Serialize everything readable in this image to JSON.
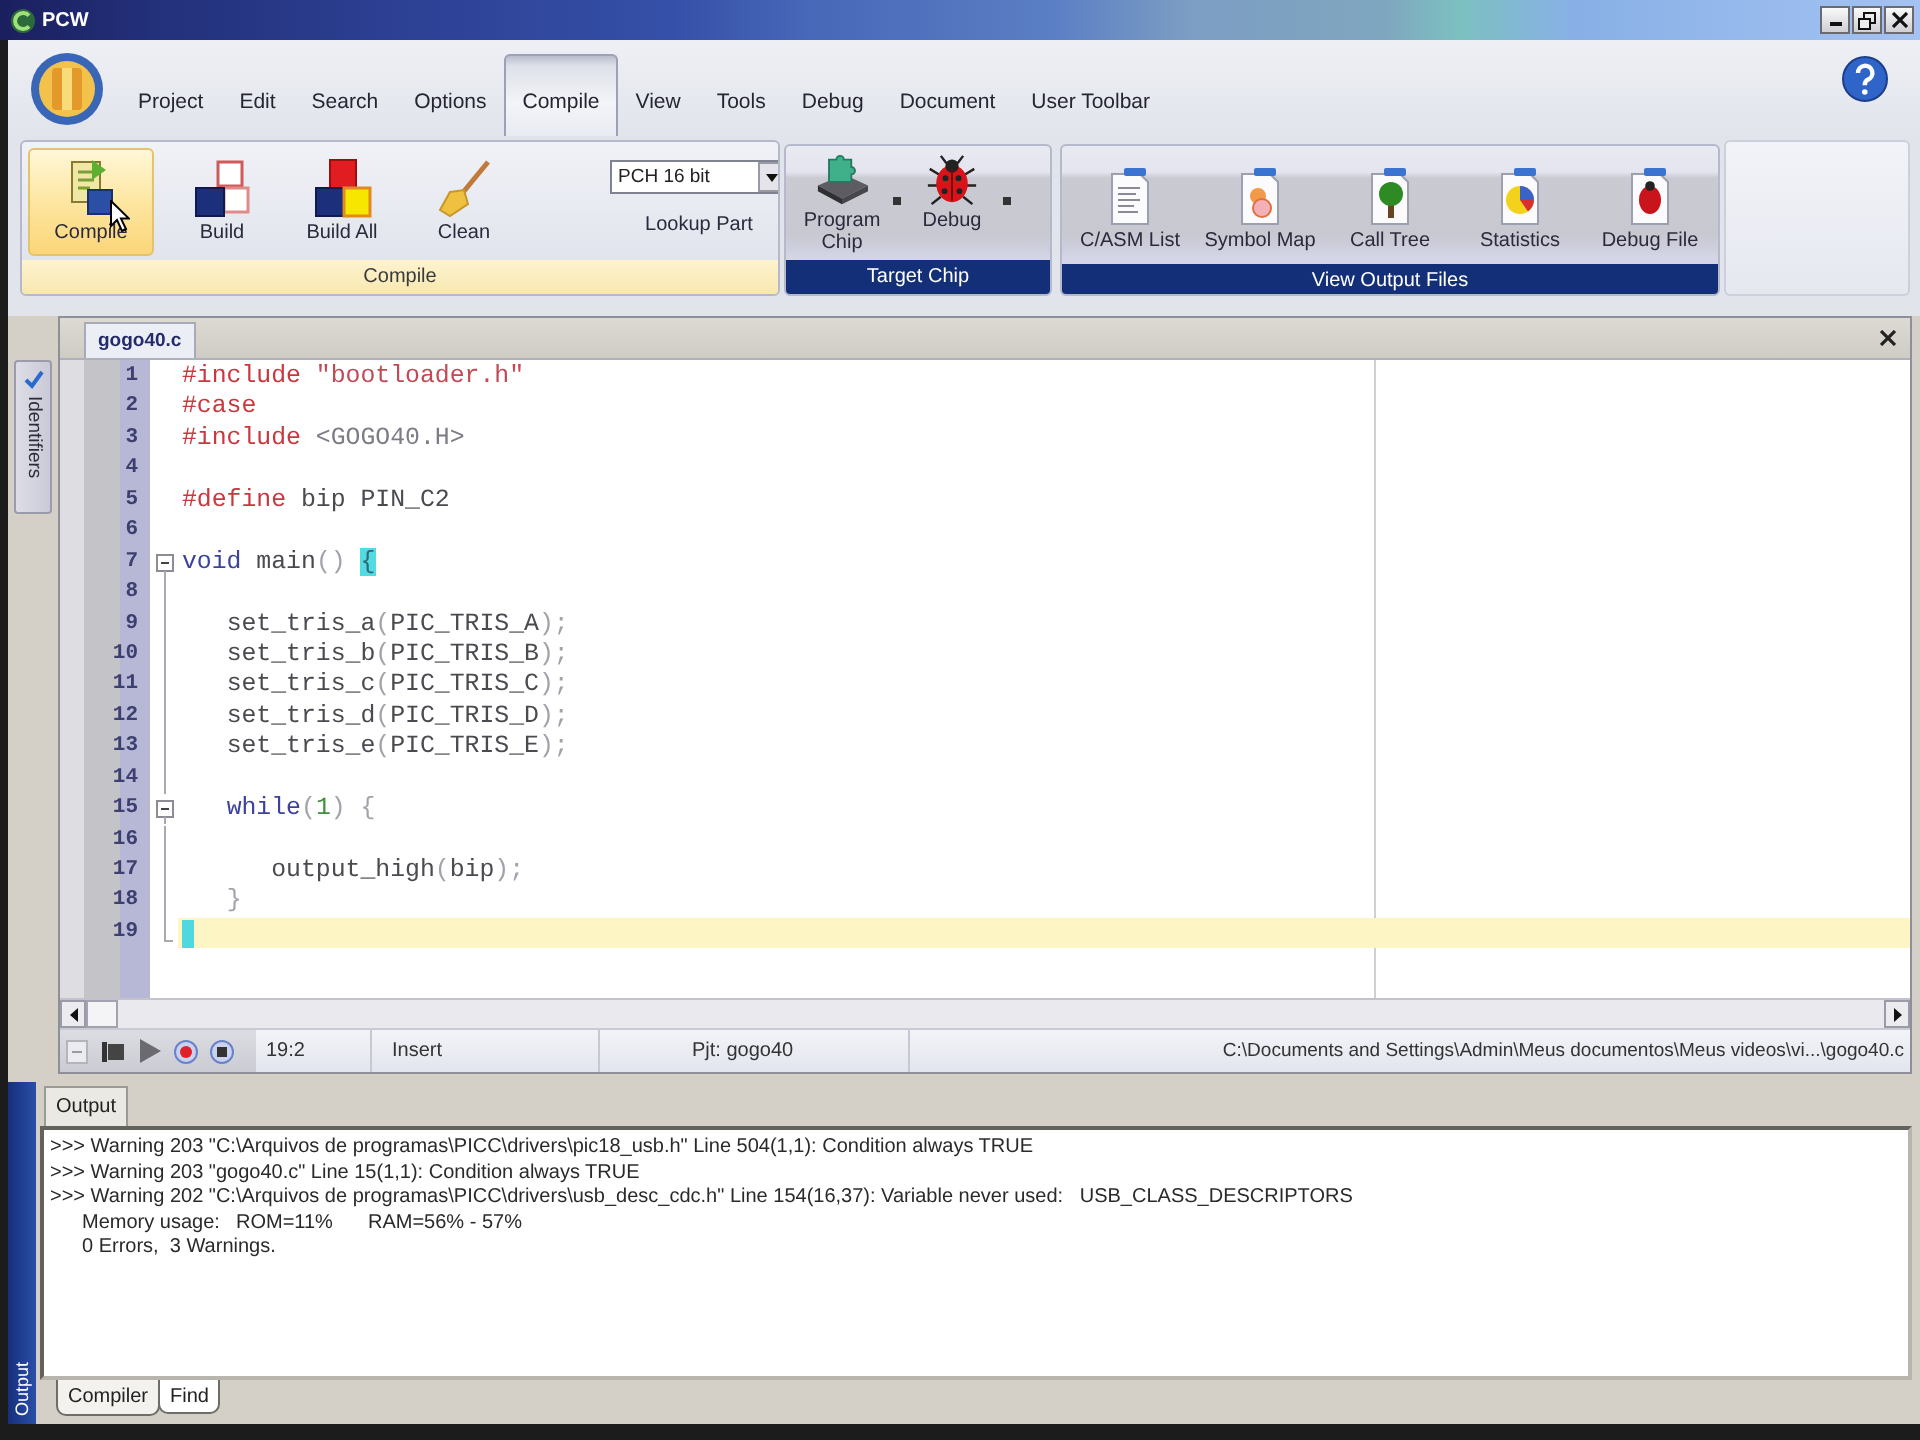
{
  "window": {
    "title": "PCW"
  },
  "menu": [
    {
      "label": "Project",
      "selected": false
    },
    {
      "label": "Edit",
      "selected": false
    },
    {
      "label": "Search",
      "selected": false
    },
    {
      "label": "Options",
      "selected": false
    },
    {
      "label": "Compile",
      "selected": true
    },
    {
      "label": "View",
      "selected": false
    },
    {
      "label": "Tools",
      "selected": false
    },
    {
      "label": "Debug",
      "selected": false
    },
    {
      "label": "Document",
      "selected": false
    },
    {
      "label": "User Toolbar",
      "selected": false
    }
  ],
  "ribbon": {
    "compile_group": {
      "label": "Compile",
      "active": true,
      "buttons": [
        {
          "label": "Compile",
          "hovered": true
        },
        {
          "label": "Build",
          "hovered": false
        },
        {
          "label": "Build All",
          "hovered": false
        },
        {
          "label": "Clean",
          "hovered": false
        }
      ],
      "compiler_select": {
        "value": "PCH 16 bit"
      },
      "lookup_button": {
        "label": "Lookup Part"
      }
    },
    "target_chip_group": {
      "label": "Target Chip",
      "active": false,
      "buttons": [
        {
          "label": "Program Chip",
          "hovered": false,
          "has_menu": true
        },
        {
          "label": "Debug",
          "hovered": false,
          "has_menu": true
        }
      ]
    },
    "output_files_group": {
      "label": "View Output Files",
      "active": false,
      "buttons": [
        {
          "label": "C/ASM List",
          "hovered": false
        },
        {
          "label": "Symbol Map",
          "hovered": false
        },
        {
          "label": "Call Tree",
          "hovered": false
        },
        {
          "label": "Statistics",
          "hovered": false
        },
        {
          "label": "Debug File",
          "hovered": false
        }
      ]
    }
  },
  "editor": {
    "side_tab": {
      "label": "Identifiers"
    },
    "tabs": [
      {
        "label": "gogo40.c",
        "selected": true
      }
    ],
    "lines": [
      {
        "number": "1",
        "tokens": [
          {
            "text": "#include ",
            "kind": "directive"
          },
          {
            "text": "\"bootloader.h\"",
            "kind": "string"
          }
        ],
        "collapsible": false,
        "current": false
      },
      {
        "number": "2",
        "tokens": [
          {
            "text": "#case",
            "kind": "directive"
          }
        ],
        "collapsible": false,
        "current": false
      },
      {
        "number": "3",
        "tokens": [
          {
            "text": "#include ",
            "kind": "directive"
          },
          {
            "text": "<GOGO40.H>",
            "kind": "header"
          }
        ],
        "collapsible": false,
        "current": false
      },
      {
        "number": "4",
        "collapsible": false,
        "current": false
      },
      {
        "number": "5",
        "tokens": [
          {
            "text": "#define ",
            "kind": "directive"
          },
          {
            "text": "bip PIN_C2",
            "kind": "ident"
          }
        ],
        "collapsible": false,
        "current": false
      },
      {
        "number": "6",
        "collapsible": false,
        "current": false
      },
      {
        "number": "7",
        "tokens": [
          {
            "text": "void",
            "kind": "keyword"
          },
          {
            "text": " main",
            "kind": "ident"
          },
          {
            "text": "() ",
            "kind": "punct"
          },
          {
            "text": "{",
            "kind": "brace_match"
          }
        ],
        "collapsible": true,
        "current": false
      },
      {
        "number": "8",
        "collapsible": false,
        "current": false
      },
      {
        "number": "9",
        "tokens": [
          {
            "text": "   set_tris_a",
            "kind": "ident"
          },
          {
            "text": "(",
            "kind": "punct"
          },
          {
            "text": "PIC_TRIS_A",
            "kind": "ident"
          },
          {
            "text": ");",
            "kind": "punct"
          }
        ],
        "collapsible": false,
        "current": false
      },
      {
        "number": "10",
        "tokens": [
          {
            "text": "   set_tris_b",
            "kind": "ident"
          },
          {
            "text": "(",
            "kind": "punct"
          },
          {
            "text": "PIC_TRIS_B",
            "kind": "ident"
          },
          {
            "text": ");",
            "kind": "punct"
          }
        ],
        "collapsible": false,
        "current": false
      },
      {
        "number": "11",
        "tokens": [
          {
            "text": "   set_tris_c",
            "kind": "ident"
          },
          {
            "text": "(",
            "kind": "punct"
          },
          {
            "text": "PIC_TRIS_C",
            "kind": "ident"
          },
          {
            "text": ");",
            "kind": "punct"
          }
        ],
        "collapsible": false,
        "current": false
      },
      {
        "number": "12",
        "tokens": [
          {
            "text": "   set_tris_d",
            "kind": "ident"
          },
          {
            "text": "(",
            "kind": "punct"
          },
          {
            "text": "PIC_TRIS_D",
            "kind": "ident"
          },
          {
            "text": ");",
            "kind": "punct"
          }
        ],
        "collapsible": false,
        "current": false
      },
      {
        "number": "13",
        "tokens": [
          {
            "text": "   set_tris_e",
            "kind": "ident"
          },
          {
            "text": "(",
            "kind": "punct"
          },
          {
            "text": "PIC_TRIS_E",
            "kind": "ident"
          },
          {
            "text": ");",
            "kind": "punct"
          }
        ],
        "collapsible": false,
        "current": false
      },
      {
        "number": "14",
        "collapsible": false,
        "current": false
      },
      {
        "number": "15",
        "tokens": [
          {
            "text": "   while",
            "kind": "keyword"
          },
          {
            "text": "(",
            "kind": "punct"
          },
          {
            "text": "1",
            "kind": "number"
          },
          {
            "text": ") {",
            "kind": "punct"
          }
        ],
        "collapsible": true,
        "current": false
      },
      {
        "number": "16",
        "collapsible": false,
        "current": false
      },
      {
        "number": "17",
        "tokens": [
          {
            "text": "      output_high",
            "kind": "ident"
          },
          {
            "text": "(",
            "kind": "punct"
          },
          {
            "text": "bip",
            "kind": "ident"
          },
          {
            "text": ");",
            "kind": "punct"
          }
        ],
        "collapsible": false,
        "current": false
      },
      {
        "number": "18",
        "tokens": [
          {
            "text": "   }",
            "kind": "punct"
          }
        ],
        "collapsible": false,
        "current": false
      },
      {
        "number": "19",
        "collapsible": false,
        "current": true
      }
    ],
    "status": {
      "position": "19:2",
      "mode": "Insert",
      "project": "Pjt: gogo40",
      "path": "C:\\Documents and Settings\\Admin\\Meus documentos\\Meus videos\\vi...\\gogo40.c"
    }
  },
  "output": {
    "side_label": "Output",
    "tab": {
      "label": "Output"
    },
    "lines": [
      {
        "kind": "warning",
        "text": ">>> Warning 203 \"C:\\Arquivos de programas\\PICC\\drivers\\pic18_usb.h\" Line 504(1,1): Condition always TRUE"
      },
      {
        "kind": "warning",
        "text": ">>> Warning 203 \"gogo40.c\" Line 15(1,1): Condition always TRUE"
      },
      {
        "kind": "warning",
        "text": ">>> Warning 202 \"C:\\Arquivos de programas\\PICC\\drivers\\usb_desc_cdc.h\" Line 154(16,37): Variable never used:   USB_CLASS_DESCRIPTORS"
      },
      {
        "kind": "stats",
        "cells": [
          "Memory usage:",
          "ROM=11%",
          "RAM=56% - 57%"
        ]
      },
      {
        "kind": "summary",
        "text": "0 Errors,  3 Warnings."
      }
    ],
    "tabs": [
      {
        "label": "Compiler",
        "selected": true
      },
      {
        "label": "Find",
        "selected": false
      }
    ]
  }
}
